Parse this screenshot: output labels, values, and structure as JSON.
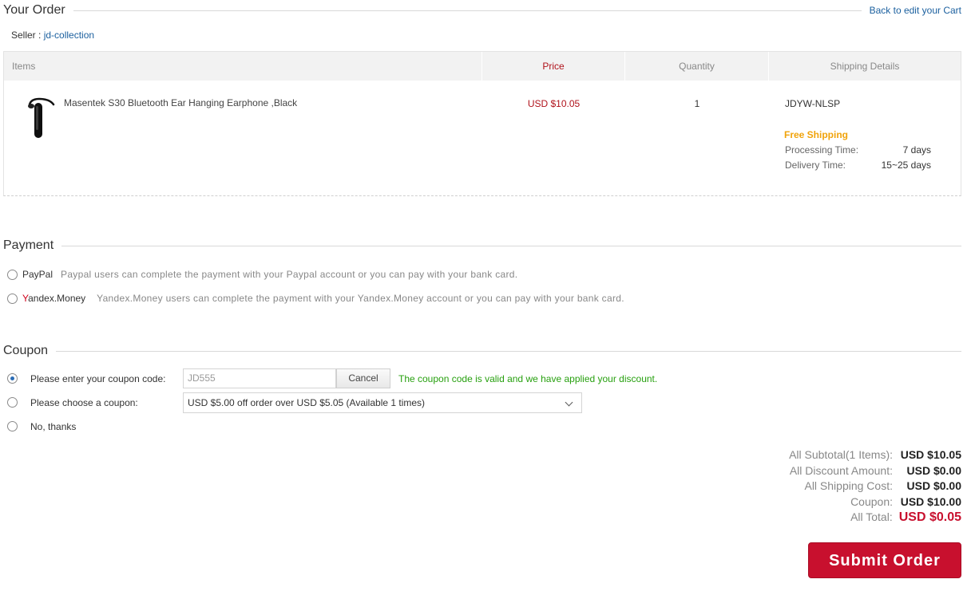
{
  "order": {
    "title": "Your Order",
    "back_link": "Back to edit your Cart",
    "seller_label": "Seller :",
    "seller_name": "jd-collection",
    "columns": {
      "items": "Items",
      "price": "Price",
      "quantity": "Quantity",
      "shipping": "Shipping Details"
    },
    "item": {
      "image": "bluetooth-earphone-image",
      "name": "Masentek S30 Bluetooth Ear Hanging Earphone ,Black",
      "price": "USD $10.05",
      "quantity": "1",
      "shipping_code": "JDYW-NLSP",
      "free_shipping": "Free Shipping",
      "processing_label": "Processing Time:",
      "processing_value": "7 days",
      "delivery_label": "Delivery Time:",
      "delivery_value": "15~25 days"
    }
  },
  "payment": {
    "title": "Payment",
    "options": [
      {
        "label": "PayPal",
        "description": "Paypal users can complete the payment with your Paypal account or you can pay with your bank card."
      },
      {
        "label_first": "Y",
        "label_rest": "andex.Money",
        "description": "Yandex.Money users can complete the payment with your Yandex.Money account or you can pay with your bank card."
      }
    ]
  },
  "coupon": {
    "title": "Coupon",
    "enter_label": "Please enter your coupon code:",
    "code_value": "JD555",
    "cancel_label": "Cancel",
    "valid_message": "The coupon code is valid and we have applied your discount.",
    "choose_label": "Please choose a coupon:",
    "selected_coupon": "USD $5.00 off order over USD $5.05 (Available 1 times)",
    "no_thanks_label": "No, thanks",
    "selected_option": "enter"
  },
  "totals": {
    "subtotal_label": "All Subtotal(1 Items):",
    "subtotal_value": "USD $10.05",
    "discount_label": "All Discount Amount:",
    "discount_value": "USD $0.00",
    "shipping_label": "All Shipping Cost:",
    "shipping_value": "USD $0.00",
    "coupon_label": "Coupon:",
    "coupon_value": "USD $10.00",
    "total_label": "All Total:",
    "total_value": "USD $0.05"
  },
  "submit_label": "Submit Order",
  "colors": {
    "accent_red": "#c8102e",
    "link_blue": "#1a5f9e",
    "free_shipping_orange": "#f0a30a",
    "valid_green": "#27a00f"
  }
}
